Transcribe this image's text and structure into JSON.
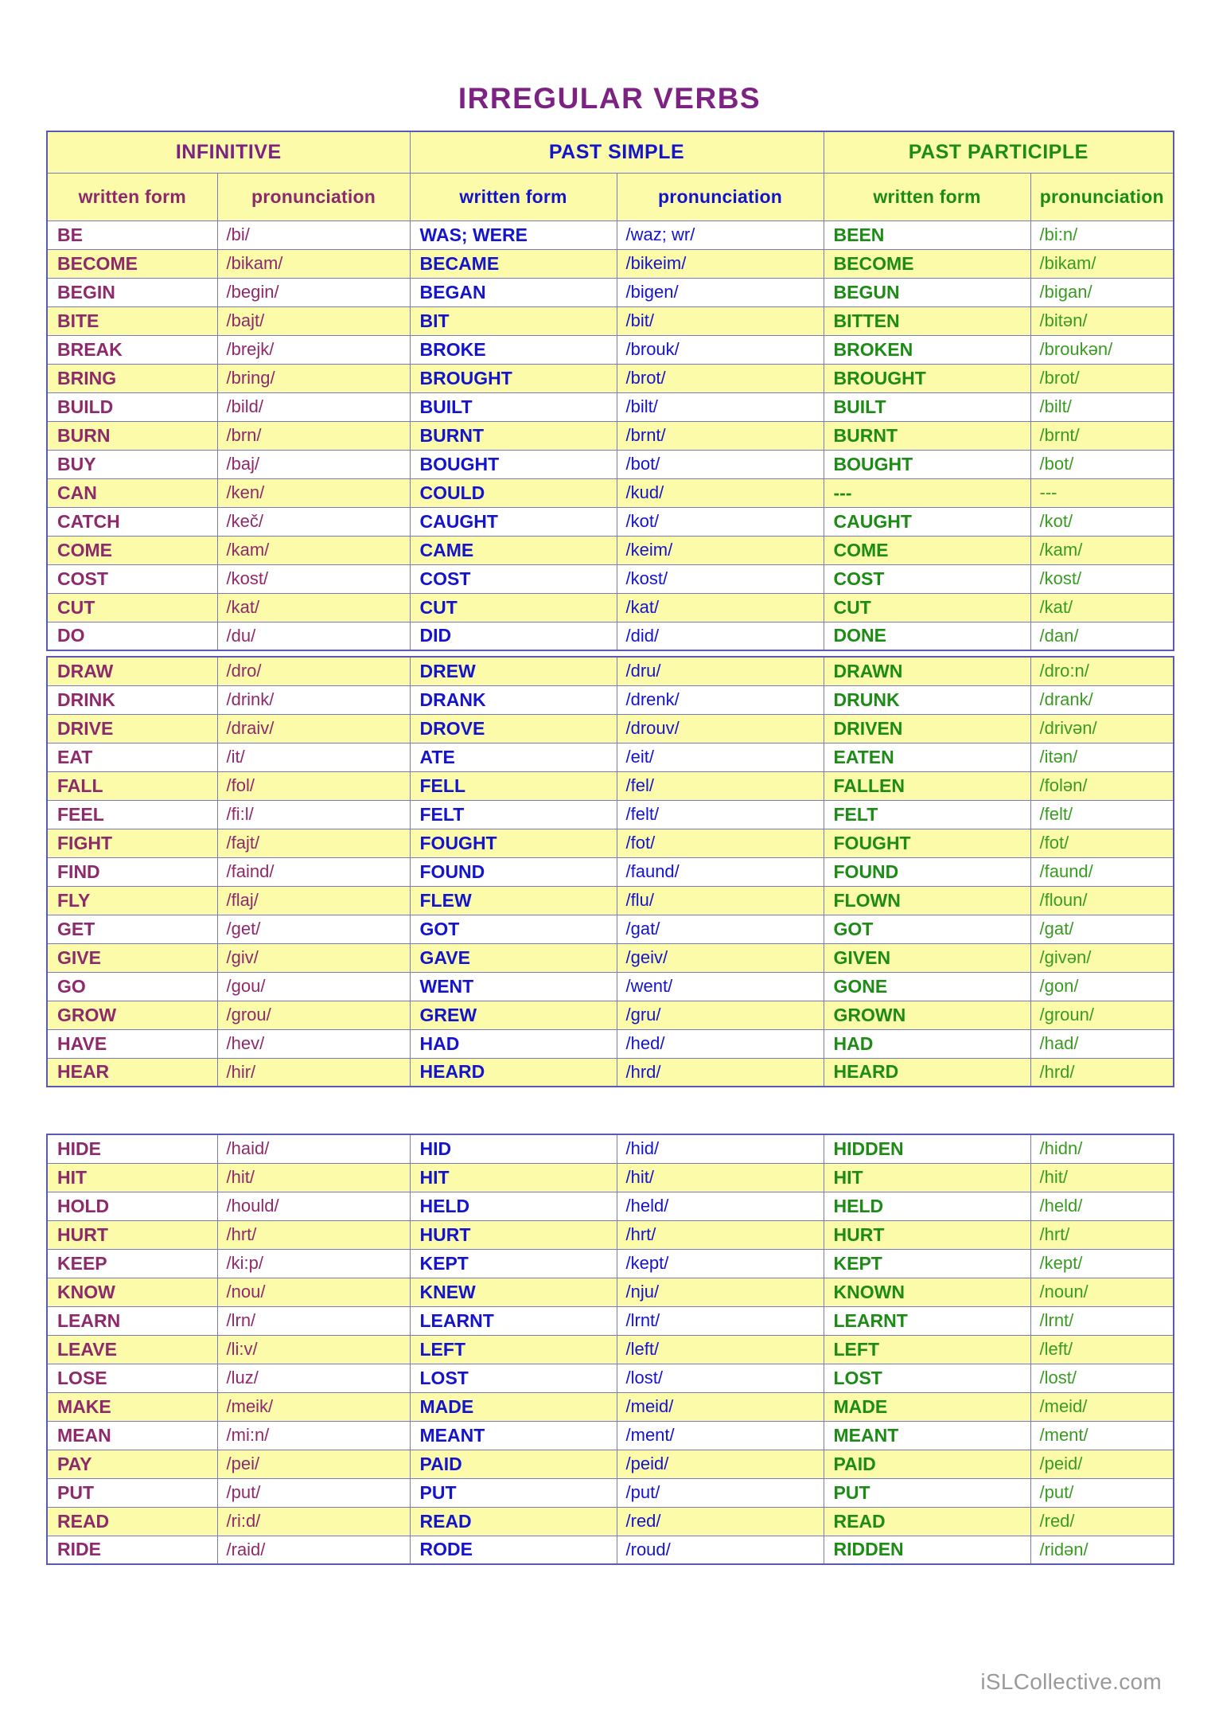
{
  "document": {
    "title": "IRREGULAR  VERBS",
    "watermark": "iSLCollective.com"
  },
  "table": {
    "group_headers": [
      {
        "label": "INFINITIVE",
        "color": "#7b2282"
      },
      {
        "label": "PAST SIMPLE",
        "color": "#1414cd"
      },
      {
        "label": "PAST PARTICIPLE",
        "color": "#1c8c14"
      }
    ],
    "sub_headers": [
      {
        "label": "written form",
        "color": "#8e2a6b"
      },
      {
        "label": "pronunciation",
        "color": "#8e2a6b"
      },
      {
        "label": "written form",
        "color": "#1414cd"
      },
      {
        "label": "pronunciation",
        "color": "#1414cd"
      },
      {
        "label": "written form",
        "color": "#1c8c14"
      },
      {
        "label": "pronunciation",
        "color": "#1c8c14"
      }
    ],
    "blocks": [
      {
        "rows": [
          {
            "inf": "BE",
            "inf_p": "/bi/",
            "ps": "WAS; WERE",
            "ps_p": "/waz; wr/",
            "pp": "BEEN",
            "pp_p": "/bi:n/"
          },
          {
            "inf": "BECOME",
            "inf_p": "/bikam/",
            "ps": "BECAME",
            "ps_p": "/bikeim/",
            "pp": "BECOME",
            "pp_p": "/bikam/"
          },
          {
            "inf": "BEGIN",
            "inf_p": "/begin/",
            "ps": "BEGAN",
            "ps_p": "/bigen/",
            "pp": "BEGUN",
            "pp_p": "/bigan/"
          },
          {
            "inf": "BITE",
            "inf_p": "/bajt/",
            "ps": "BIT",
            "ps_p": "/bit/",
            "pp": "BITTEN",
            "pp_p": "/bitən/"
          },
          {
            "inf": "BREAK",
            "inf_p": "/brejk/",
            "ps": "BROKE",
            "ps_p": "/brouk/",
            "pp": "BROKEN",
            "pp_p": "/broukən/"
          },
          {
            "inf": "BRING",
            "inf_p": "/bring/",
            "ps": "BROUGHT",
            "ps_p": "/brot/",
            "pp": "BROUGHT",
            "pp_p": "/brot/"
          },
          {
            "inf": "BUILD",
            "inf_p": "/bild/",
            "ps": "BUILT",
            "ps_p": "/bilt/",
            "pp": "BUILT",
            "pp_p": "/bilt/"
          },
          {
            "inf": "BURN",
            "inf_p": "/brn/",
            "ps": "BURNT",
            "ps_p": "/brnt/",
            "pp": "BURNT",
            "pp_p": "/brnt/"
          },
          {
            "inf": "BUY",
            "inf_p": "/baj/",
            "ps": "BOUGHT",
            "ps_p": "/bot/",
            "pp": "BOUGHT",
            "pp_p": "/bot/"
          },
          {
            "inf": "CAN",
            "inf_p": "/ken/",
            "ps": "COULD",
            "ps_p": "/kud/",
            "pp": "---",
            "pp_p": "---"
          },
          {
            "inf": "CATCH",
            "inf_p": "/keč/",
            "ps": "CAUGHT",
            "ps_p": "/kot/",
            "pp": "CAUGHT",
            "pp_p": "/kot/"
          },
          {
            "inf": "COME",
            "inf_p": "/kam/",
            "ps": "CAME",
            "ps_p": "/keim/",
            "pp": "COME",
            "pp_p": "/kam/"
          },
          {
            "inf": "COST",
            "inf_p": "/kost/",
            "ps": "COST",
            "ps_p": "/kost/",
            "pp": "COST",
            "pp_p": "/kost/"
          },
          {
            "inf": "CUT",
            "inf_p": "/kat/",
            "ps": "CUT",
            "ps_p": "/kat/",
            "pp": "CUT",
            "pp_p": "/kat/"
          },
          {
            "inf": "DO",
            "inf_p": "/du/",
            "ps": "DID",
            "ps_p": "/did/",
            "pp": "DONE",
            "pp_p": "/dan/"
          }
        ]
      },
      {
        "rows": [
          {
            "inf": "DRAW",
            "inf_p": "/dro/",
            "ps": "DREW",
            "ps_p": "/dru/",
            "pp": "DRAWN",
            "pp_p": "/dro:n/"
          },
          {
            "inf": "DRINK",
            "inf_p": "/drink/",
            "ps": "DRANK",
            "ps_p": "/drenk/",
            "pp": "DRUNK",
            "pp_p": "/drank/"
          },
          {
            "inf": "DRIVE",
            "inf_p": "/draiv/",
            "ps": "DROVE",
            "ps_p": "/drouv/",
            "pp": "DRIVEN",
            "pp_p": "/drivən/"
          },
          {
            "inf": "EAT",
            "inf_p": "/it/",
            "ps": "ATE",
            "ps_p": "/eit/",
            "pp": "EATEN",
            "pp_p": "/itən/"
          },
          {
            "inf": "FALL",
            "inf_p": "/fol/",
            "ps": "FELL",
            "ps_p": "/fel/",
            "pp": "FALLEN",
            "pp_p": "/folən/"
          },
          {
            "inf": "FEEL",
            "inf_p": "/fi:l/",
            "ps": "FELT",
            "ps_p": "/felt/",
            "pp": "FELT",
            "pp_p": "/felt/"
          },
          {
            "inf": "FIGHT",
            "inf_p": "/fajt/",
            "ps": "FOUGHT",
            "ps_p": "/fot/",
            "pp": "FOUGHT",
            "pp_p": "/fot/"
          },
          {
            "inf": "FIND",
            "inf_p": "/faind/",
            "ps": "FOUND",
            "ps_p": "/faund/",
            "pp": "FOUND",
            "pp_p": "/faund/"
          },
          {
            "inf": "FLY",
            "inf_p": "/flaj/",
            "ps": "FLEW",
            "ps_p": "/flu/",
            "pp": "FLOWN",
            "pp_p": "/floun/"
          },
          {
            "inf": "GET",
            "inf_p": "/get/",
            "ps": "GOT",
            "ps_p": "/gat/",
            "pp": "GOT",
            "pp_p": "/gat/"
          },
          {
            "inf": "GIVE",
            "inf_p": "/giv/",
            "ps": "GAVE",
            "ps_p": "/geiv/",
            "pp": "GIVEN",
            "pp_p": "/givən/"
          },
          {
            "inf": "GO",
            "inf_p": "/gou/",
            "ps": "WENT",
            "ps_p": "/went/",
            "pp": "GONE",
            "pp_p": "/gon/"
          },
          {
            "inf": "GROW",
            "inf_p": "/grou/",
            "ps": "GREW",
            "ps_p": "/gru/",
            "pp": "GROWN",
            "pp_p": "/groun/"
          },
          {
            "inf": "HAVE",
            "inf_p": "/hev/",
            "ps": "HAD",
            "ps_p": "/hed/",
            "pp": "HAD",
            "pp_p": "/had/"
          },
          {
            "inf": "HEAR",
            "inf_p": "/hir/",
            "ps": "HEARD",
            "ps_p": "/hrd/",
            "pp": "HEARD",
            "pp_p": "/hrd/"
          }
        ]
      },
      {
        "rows": [
          {
            "inf": "HIDE",
            "inf_p": "/haid/",
            "ps": "HID",
            "ps_p": "/hid/",
            "pp": "HIDDEN",
            "pp_p": "/hidn/"
          },
          {
            "inf": "HIT",
            "inf_p": "/hit/",
            "ps": "HIT",
            "ps_p": "/hit/",
            "pp": "HIT",
            "pp_p": "/hit/"
          },
          {
            "inf": "HOLD",
            "inf_p": "/hould/",
            "ps": "HELD",
            "ps_p": "/held/",
            "pp": "HELD",
            "pp_p": "/held/"
          },
          {
            "inf": "HURT",
            "inf_p": "/hrt/",
            "ps": "HURT",
            "ps_p": "/hrt/",
            "pp": "HURT",
            "pp_p": "/hrt/"
          },
          {
            "inf": "KEEP",
            "inf_p": "/ki:p/",
            "ps": "KEPT",
            "ps_p": "/kept/",
            "pp": "KEPT",
            "pp_p": "/kept/"
          },
          {
            "inf": "KNOW",
            "inf_p": "/nou/",
            "ps": "KNEW",
            "ps_p": "/nju/",
            "pp": "KNOWN",
            "pp_p": "/noun/"
          },
          {
            "inf": "LEARN",
            "inf_p": "/lrn/",
            "ps": "LEARNT",
            "ps_p": "/lrnt/",
            "pp": "LEARNT",
            "pp_p": "/lrnt/"
          },
          {
            "inf": "LEAVE",
            "inf_p": "/li:v/",
            "ps": "LEFT",
            "ps_p": "/left/",
            "pp": "LEFT",
            "pp_p": "/left/"
          },
          {
            "inf": "LOSE",
            "inf_p": "/luz/",
            "ps": "LOST",
            "ps_p": "/lost/",
            "pp": "LOST",
            "pp_p": "/lost/"
          },
          {
            "inf": "MAKE",
            "inf_p": "/meik/",
            "ps": "MADE",
            "ps_p": "/meid/",
            "pp": "MADE",
            "pp_p": "/meid/"
          },
          {
            "inf": "MEAN",
            "inf_p": "/mi:n/",
            "ps": "MEANT",
            "ps_p": "/ment/",
            "pp": "MEANT",
            "pp_p": "/ment/"
          },
          {
            "inf": "PAY",
            "inf_p": "/pei/",
            "ps": "PAID",
            "ps_p": "/peid/",
            "pp": "PAID",
            "pp_p": "/peid/"
          },
          {
            "inf": "PUT",
            "inf_p": "/put/",
            "ps": "PUT",
            "ps_p": "/put/",
            "pp": "PUT",
            "pp_p": "/put/"
          },
          {
            "inf": "READ",
            "inf_p": "/ri:d/",
            "ps": "READ",
            "ps_p": "/red/",
            "pp": "READ",
            "pp_p": "/red/"
          },
          {
            "inf": "RIDE",
            "inf_p": "/raid/",
            "ps": "RODE",
            "ps_p": "/roud/",
            "pp": "RIDDEN",
            "pp_p": "/ridən/"
          }
        ]
      }
    ]
  }
}
